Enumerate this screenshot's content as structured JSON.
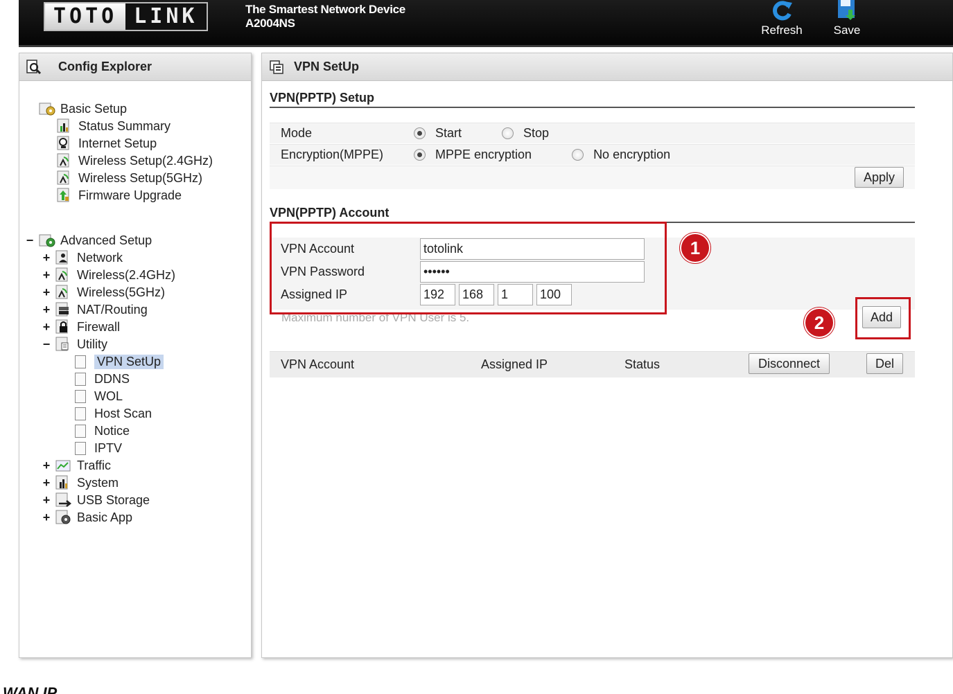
{
  "header": {
    "logo_left": "TOTO",
    "logo_right": "LINK",
    "tagline": "The Smartest Network Device",
    "model": "A2004NS",
    "refresh_label": "Refresh",
    "save_label": "Save"
  },
  "sidebar": {
    "title": "Config Explorer",
    "basic": {
      "label": "Basic Setup",
      "items": [
        "Status Summary",
        "Internet Setup",
        "Wireless Setup(2.4GHz)",
        "Wireless Setup(5GHz)",
        "Firmware Upgrade"
      ]
    },
    "advanced": {
      "label": "Advanced Setup",
      "expander": "−",
      "items": [
        {
          "label": "Network",
          "expander": "+"
        },
        {
          "label": "Wireless(2.4GHz)",
          "expander": "+"
        },
        {
          "label": "Wireless(5GHz)",
          "expander": "+"
        },
        {
          "label": "NAT/Routing",
          "expander": "+"
        },
        {
          "label": "Firewall",
          "expander": "+"
        },
        {
          "label": "Utility",
          "expander": "−"
        }
      ],
      "utility_items": [
        "VPN SetUp",
        "DDNS",
        "WOL",
        "Host Scan",
        "Notice",
        "IPTV"
      ],
      "more_items": [
        {
          "label": "Traffic",
          "expander": "+"
        },
        {
          "label": "System",
          "expander": "+"
        },
        {
          "label": "USB Storage",
          "expander": "+"
        },
        {
          "label": "Basic App",
          "expander": "+"
        }
      ],
      "selected": "VPN SetUp"
    }
  },
  "main": {
    "title": "VPN SetUp",
    "setup": {
      "title": "VPN(PPTP) Setup",
      "mode_label": "Mode",
      "mode_options": [
        "Start",
        "Stop"
      ],
      "mode_selected": "Start",
      "encryption_label": "Encryption(MPPE)",
      "encryption_options": [
        "MPPE encryption",
        "No encryption"
      ],
      "encryption_selected": "MPPE encryption",
      "apply_label": "Apply"
    },
    "account": {
      "title": "VPN(PPTP) Account",
      "vpn_account_label": "VPN Account",
      "vpn_account_value": "totolink",
      "vpn_password_label": "VPN Password",
      "vpn_password_value": "••••••",
      "assigned_ip_label": "Assigned IP",
      "ip": [
        "192",
        "168",
        "1",
        "100"
      ],
      "hint": "Maximum number of VPN User is 5.",
      "add_label": "Add"
    },
    "list": {
      "col_account": "VPN Account",
      "col_ip": "Assigned IP",
      "col_status": "Status",
      "disconnect_label": "Disconnect",
      "del_label": "Del"
    },
    "annotations": {
      "badge1": "1",
      "badge2": "2",
      "color": "#c8161d"
    }
  },
  "footer": {
    "text": "WAN IP"
  }
}
